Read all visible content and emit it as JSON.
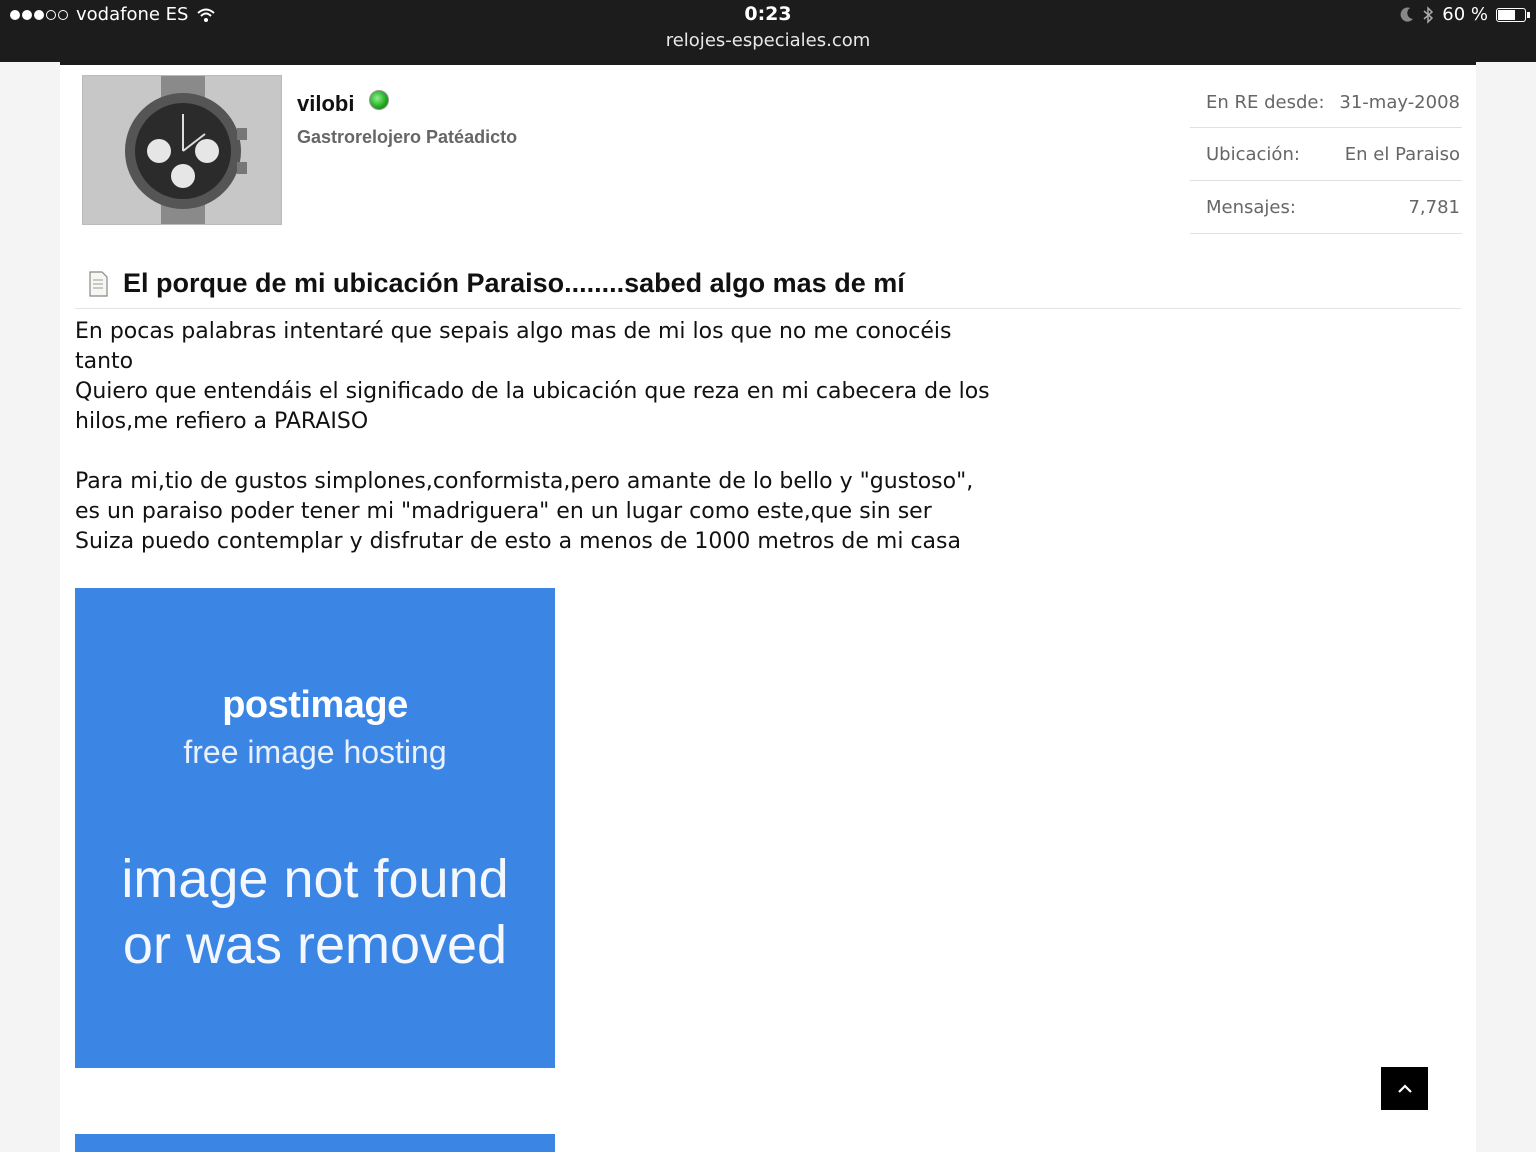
{
  "status_bar": {
    "carrier": "vodafone ES",
    "time": "0:23",
    "url": "relojes-especiales.com",
    "battery": "60 %",
    "battery_level": 0.6
  },
  "profile": {
    "username": "vilobi",
    "title": "Gastrorelojero Patéadicto",
    "stats": [
      {
        "label": "En RE desde:",
        "value": "31-may-2008"
      },
      {
        "label": "Ubicación:",
        "value": "En el Paraiso"
      },
      {
        "label": "Mensajes:",
        "value": "7,781"
      }
    ]
  },
  "post": {
    "title": "El porque de mi ubicación Paraiso........sabed algo mas de mí",
    "lines": [
      "En pocas palabras intentaré que sepais algo mas de mi los que no me conocéis",
      "tanto",
      "Quiero que entendáis el significado de la ubicación que reza en mi cabecera de los",
      "hilos,me refiero a PARAISO",
      "Para mi,tio de gustos simplones,conformista,pero amante de lo bello y \"gustoso\",",
      "es un paraiso poder tener mi \"madriguera\" en un lugar como este,que sin ser",
      "Suiza puedo contemplar y disfrutar de esto a menos de 1000 metros de mi casa"
    ],
    "image": {
      "brand": "postimage",
      "tagline": "free image hosting",
      "message_line1": "image not found",
      "message_line2": "or was removed",
      "color": "#3b86e5"
    }
  },
  "icons": {
    "wifi": "wifi-icon",
    "moon": "moon-icon",
    "bluetooth": "bluetooth-icon",
    "battery": "battery-icon",
    "online": "online-status-icon",
    "document": "document-icon",
    "back_to_top": "chevron-up-icon"
  }
}
